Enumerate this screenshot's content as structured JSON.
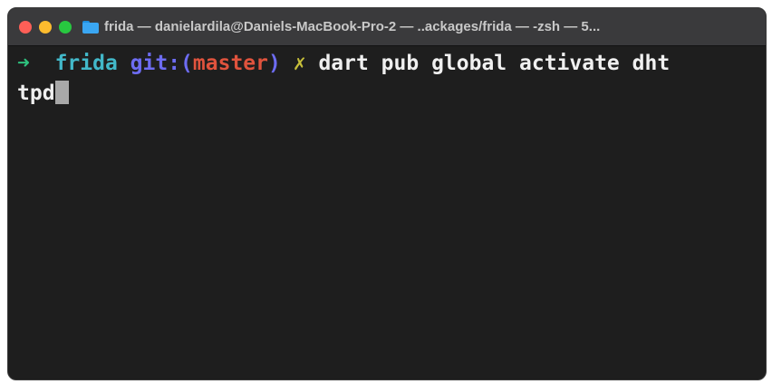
{
  "window": {
    "title": "frida — danielardila@Daniels-MacBook-Pro-2 — ..ackages/frida — -zsh — 5..."
  },
  "prompt": {
    "arrow": "➜",
    "directory": "frida",
    "git_label": "git:(",
    "branch": "master",
    "git_close": ")",
    "dirty_marker": "✗",
    "command_line1": " dart pub global activate dht",
    "command_line2": "tpd"
  },
  "colors": {
    "background": "#1e1e1e",
    "arrow": "#2ec27e",
    "directory": "#42b8c9",
    "git": "#6d6cf2",
    "branch": "#e0533d",
    "dirty": "#c7bf3a"
  },
  "icons": {
    "close": "close-light-icon",
    "minimize": "minimize-light-icon",
    "maximize": "maximize-light-icon",
    "folder": "folder-icon"
  }
}
